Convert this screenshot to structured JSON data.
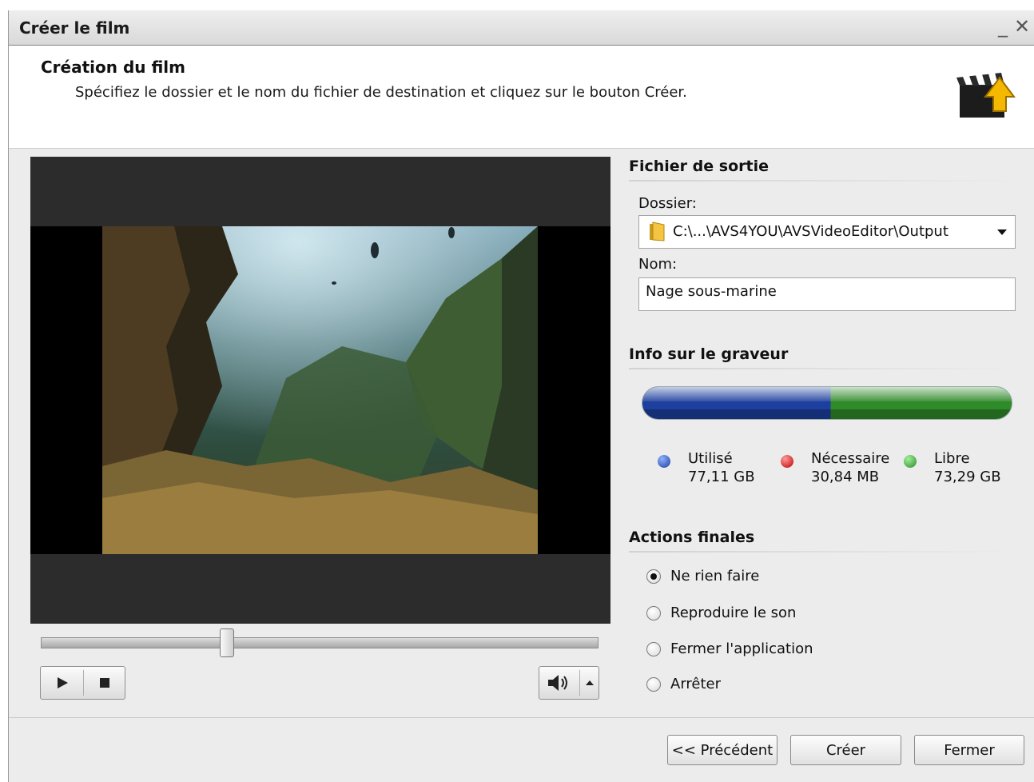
{
  "window": {
    "title": "Créer le film",
    "minimize_glyph": "_",
    "close_glyph": "✕"
  },
  "header": {
    "title": "Création du film",
    "subtitle": "Spécifiez le dossier et le nom du fichier de destination et cliquez sur le bouton Créer.",
    "icon": "film-clapper-export-icon"
  },
  "player": {
    "seek_position": 0.33,
    "play_icon": "play-icon",
    "stop_icon": "stop-icon",
    "volume_icon": "speaker-icon",
    "volume_menu_icon": "triangle-up-icon"
  },
  "output": {
    "section_title": "Fichier de sortie",
    "folder_label": "Dossier:",
    "folder_value": "C:\\...\\AVS4YOU\\AVSVideoEditor\\Output",
    "name_label": "Nom:",
    "name_value": "Nage sous-marine"
  },
  "disk": {
    "section_title": "Info sur le graveur",
    "used_label": "Utilisé",
    "used_value": "77,11 GB",
    "used_color": "#1d3f9e",
    "required_label": "Nécessaire",
    "required_value": "30,84 MB",
    "required_color": "#d01010",
    "free_label": "Libre",
    "free_value": "73,29 GB",
    "free_color": "#2f8a2a"
  },
  "final_actions": {
    "section_title": "Actions finales",
    "options": [
      {
        "label": "Ne rien faire",
        "checked": true
      },
      {
        "label": "Reproduire le son",
        "checked": false
      },
      {
        "label": "Fermer l'application",
        "checked": false
      },
      {
        "label": "Arrêter",
        "checked": false
      }
    ]
  },
  "footer": {
    "back_label": "<< Précédent",
    "create_label": "Créer",
    "close_label": "Fermer"
  }
}
